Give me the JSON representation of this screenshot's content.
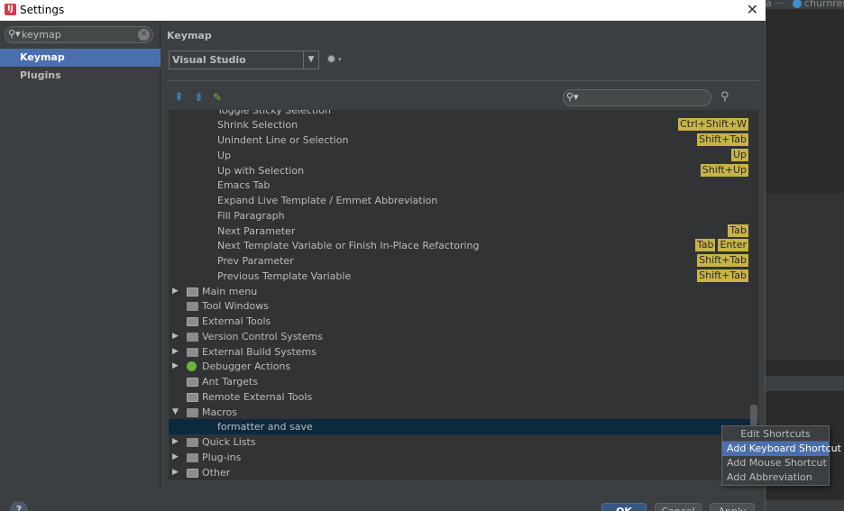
{
  "window": {
    "title": "Settings",
    "app_icon": "ij-logo-icon",
    "close_glyph": "✕"
  },
  "background_ide": {
    "tab1_text": "a ···",
    "tab2_text": "churnres"
  },
  "sidebar": {
    "search": {
      "value": "keymap"
    },
    "items": [
      {
        "label": "Keymap",
        "selected": true
      },
      {
        "label": "Plugins",
        "selected": false
      }
    ]
  },
  "main": {
    "heading": "Keymap",
    "keymap_select": {
      "value": "Visual Studio",
      "arrow": "▼"
    },
    "gear_arrow": "▾"
  },
  "tree": {
    "rows": [
      {
        "label": "Toggle Sticky Selection",
        "level": 2,
        "shortcuts": []
      },
      {
        "label": "Shrink Selection",
        "level": 2,
        "shortcuts": [
          "Ctrl+Shift+W"
        ]
      },
      {
        "label": "Unindent Line or Selection",
        "level": 2,
        "shortcuts": [
          "Shift+Tab"
        ]
      },
      {
        "label": "Up",
        "level": 2,
        "shortcuts": [
          "Up"
        ]
      },
      {
        "label": "Up with Selection",
        "level": 2,
        "shortcuts": [
          "Shift+Up"
        ]
      },
      {
        "label": "Emacs Tab",
        "level": 2,
        "shortcuts": []
      },
      {
        "label": "Expand Live Template / Emmet Abbreviation",
        "level": 2,
        "shortcuts": []
      },
      {
        "label": "Fill Paragraph",
        "level": 2,
        "shortcuts": []
      },
      {
        "label": "Next Parameter",
        "level": 2,
        "shortcuts": [
          "Tab"
        ]
      },
      {
        "label": "Next Template Variable or Finish In-Place Refactoring",
        "level": 2,
        "shortcuts": [
          "Tab",
          "Enter"
        ]
      },
      {
        "label": "Prev Parameter",
        "level": 2,
        "shortcuts": [
          "Shift+Tab"
        ]
      },
      {
        "label": "Previous Template Variable",
        "level": 2,
        "shortcuts": [
          "Shift+Tab"
        ]
      },
      {
        "label": "Main menu",
        "level": 1,
        "expand": "▶",
        "icon": "menu-folder-icon"
      },
      {
        "label": "Tool Windows",
        "level": 1,
        "expand": "",
        "icon": "folder-icon"
      },
      {
        "label": "External Tools",
        "level": 1,
        "expand": "",
        "icon": "tools-folder-icon"
      },
      {
        "label": "Version Control Systems",
        "level": 1,
        "expand": "▶",
        "icon": "folder-icon"
      },
      {
        "label": "External Build Systems",
        "level": 1,
        "expand": "▶",
        "icon": "build-folder-icon"
      },
      {
        "label": "Debugger Actions",
        "level": 1,
        "expand": "▶",
        "icon": "debugger-bug-icon"
      },
      {
        "label": "Ant Targets",
        "level": 1,
        "expand": "",
        "icon": "ant-folder-icon"
      },
      {
        "label": "Remote External Tools",
        "level": 1,
        "expand": "",
        "icon": "tools-folder-icon"
      },
      {
        "label": "Macros",
        "level": 1,
        "expand": "▼",
        "icon": "folder-icon"
      },
      {
        "label": "formatter and save",
        "level": 2,
        "selected": true,
        "shortcuts": []
      },
      {
        "label": "Quick Lists",
        "level": 1,
        "expand": "▶",
        "icon": "folder-icon"
      },
      {
        "label": "Plug-ins",
        "level": 1,
        "expand": "▶",
        "icon": "folder-icon"
      },
      {
        "label": "Other",
        "level": 1,
        "expand": "▶",
        "icon": "other-folder-icon"
      }
    ]
  },
  "context_menu": {
    "header": "Edit Shortcuts",
    "items": [
      {
        "label": "Add Keyboard Shortcut",
        "highlighted": true
      },
      {
        "label": "Add Mouse Shortcut",
        "highlighted": false
      },
      {
        "label": "Add Abbreviation",
        "highlighted": false
      }
    ]
  },
  "footer": {
    "help_label": "?",
    "ok_label": "OK",
    "cancel_label": "Cancel",
    "apply_label": "Apply"
  },
  "colors": {
    "selection": "#4b6eaf",
    "shortcut_bg": "#c7b347",
    "tree_selected": "#0d293e"
  }
}
